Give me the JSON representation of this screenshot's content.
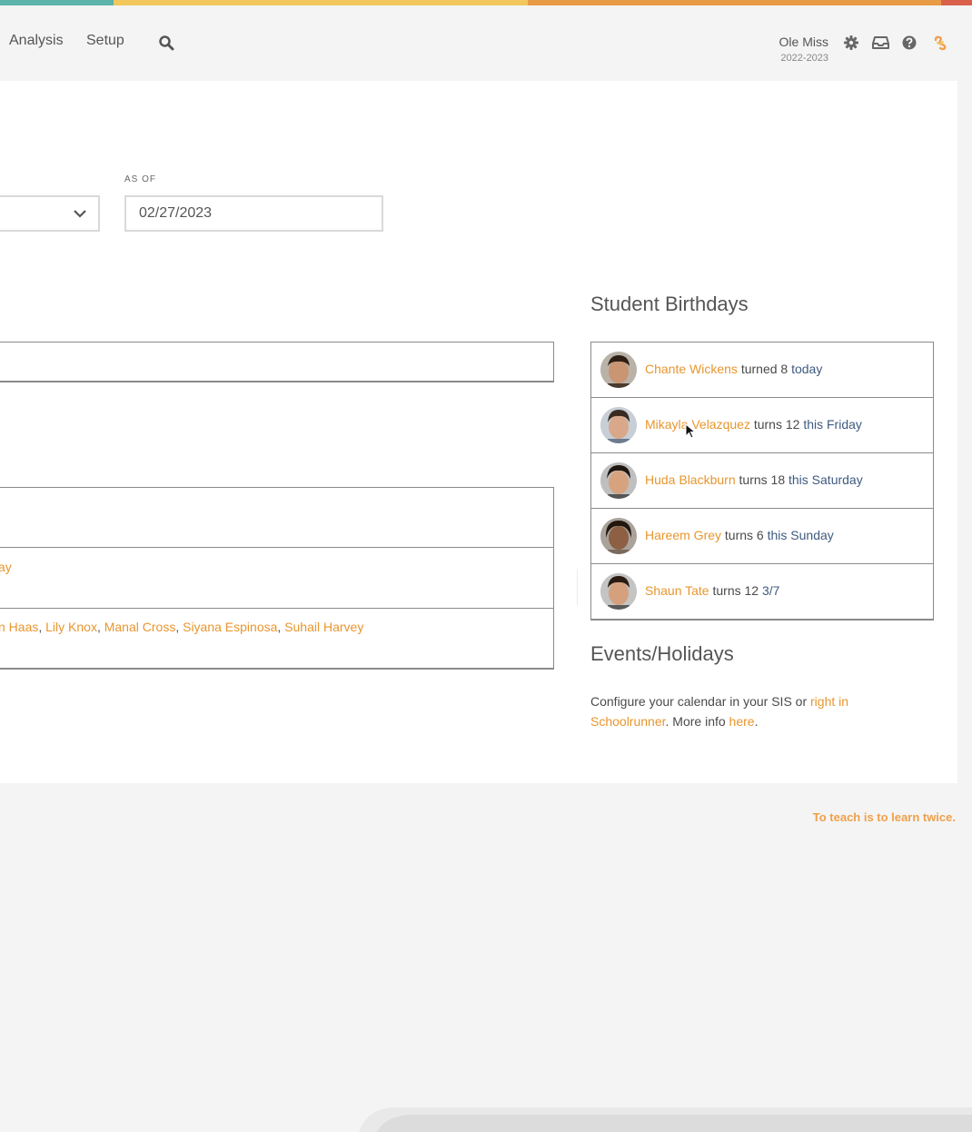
{
  "colors": {
    "stripe": [
      "#5bb3ab",
      "#f2c75c",
      "#e89a44",
      "#d9614c"
    ],
    "accent": "#e8962e",
    "secondary_link": "#3e5a80"
  },
  "nav": {
    "items": [
      "Analysis",
      "Setup"
    ],
    "search_icon": "search-icon",
    "school": "Ole Miss",
    "year": "2022-2023",
    "icons": [
      "gear-icon",
      "inbox-icon",
      "help-icon",
      "brand-logo-icon"
    ]
  },
  "filters": {
    "as_of_label": "AS OF",
    "as_of_value": "02/27/2023"
  },
  "left_rows": {
    "row2_link": "ay",
    "row3_names": [
      "n Haas",
      "Lily Knox",
      "Manal Cross",
      "Siyana Espinosa",
      "Suhail Harvey"
    ]
  },
  "birthdays": {
    "title": "Student Birthdays",
    "items": [
      {
        "name": "Chante Wickens",
        "verb": "turned 8",
        "when": "today"
      },
      {
        "name": "Mikayla Velazquez",
        "verb": "turns 12",
        "when": "this Friday"
      },
      {
        "name": "Huda Blackburn",
        "verb": "turns 18",
        "when": "this Saturday"
      },
      {
        "name": "Hareem Grey",
        "verb": "turns 6",
        "when": "this Sunday"
      },
      {
        "name": "Shaun Tate",
        "verb": "turns 12",
        "when": "3/7"
      }
    ]
  },
  "events": {
    "title": "Events/Holidays",
    "text_before": "Configure your calendar in your SIS or ",
    "link1": "right in Schoolrunner",
    "text_middle": ". More info ",
    "link2": "here",
    "text_after": "."
  },
  "footer": {
    "quote": "To teach is to learn twice."
  }
}
